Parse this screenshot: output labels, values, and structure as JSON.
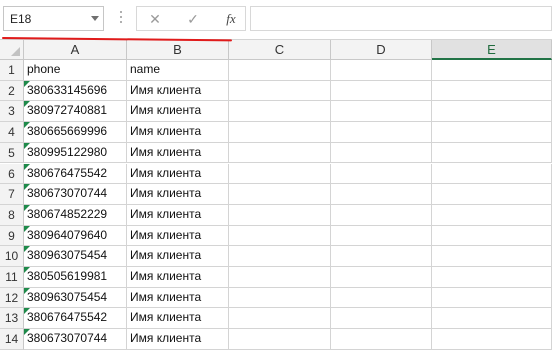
{
  "formula_bar": {
    "name_box": "E18",
    "cancel_glyph": "✕",
    "enter_glyph": "✓",
    "fx_label": "fx",
    "formula_value": ""
  },
  "sheet": {
    "columns": [
      "A",
      "B",
      "C",
      "D",
      "E"
    ],
    "selected_column": "E",
    "rows": [
      {
        "n": "1",
        "a": "phone",
        "b": "name",
        "number_as_text": false
      },
      {
        "n": "2",
        "a": "380633145696",
        "b": "Имя клиента",
        "number_as_text": true
      },
      {
        "n": "3",
        "a": "380972740881",
        "b": "Имя клиента",
        "number_as_text": true
      },
      {
        "n": "4",
        "a": "380665669996",
        "b": "Имя клиента",
        "number_as_text": true
      },
      {
        "n": "5",
        "a": "380995122980",
        "b": "Имя клиента",
        "number_as_text": true
      },
      {
        "n": "6",
        "a": "380676475542",
        "b": "Имя клиента",
        "number_as_text": true
      },
      {
        "n": "7",
        "a": "380673070744",
        "b": "Имя клиента",
        "number_as_text": true
      },
      {
        "n": "8",
        "a": "380674852229",
        "b": "Имя клиента",
        "number_as_text": true
      },
      {
        "n": "9",
        "a": "380964079640",
        "b": "Имя клиента",
        "number_as_text": true
      },
      {
        "n": "10",
        "a": "380963075454",
        "b": "Имя клиента",
        "number_as_text": true
      },
      {
        "n": "11",
        "a": "380505619981",
        "b": "Имя клиента",
        "number_as_text": true
      },
      {
        "n": "12",
        "a": "380963075454",
        "b": "Имя клиента",
        "number_as_text": true
      },
      {
        "n": "13",
        "a": "380676475542",
        "b": "Имя клиента",
        "number_as_text": true
      },
      {
        "n": "14",
        "a": "380673070744",
        "b": "Имя клиента",
        "number_as_text": true
      }
    ]
  },
  "colors": {
    "selected_header_accent": "#217346",
    "error_indicator": "#1e8a4a",
    "annotation_underline": "#e01b1b"
  }
}
